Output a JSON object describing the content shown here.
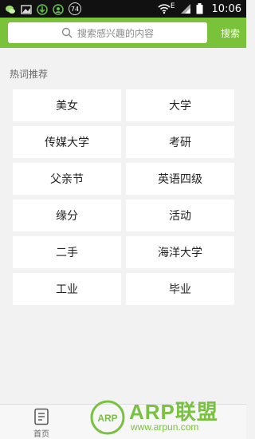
{
  "status_bar": {
    "time": "10:06",
    "badge": "74",
    "network": "E",
    "icons": [
      "wechat-icon",
      "image-icon",
      "download-icon",
      "user-icon",
      "wifi-icon",
      "signal-icon",
      "battery-icon"
    ]
  },
  "search": {
    "placeholder": "搜索感兴趣的内容",
    "button_label": "搜索",
    "accent_color": "#79c23a"
  },
  "hot": {
    "title": "热词推荐",
    "tags": [
      "美女",
      "大学",
      "传媒大学",
      "考研",
      "父亲节",
      "英语四级",
      "缘分",
      "活动",
      "二手",
      "海洋大学",
      "工业",
      "毕业"
    ]
  },
  "bottom_nav": {
    "home_label": "首页"
  },
  "watermark": {
    "logo_text": "ARP",
    "main": "ARP联盟",
    "url": "www.arpun.com"
  }
}
